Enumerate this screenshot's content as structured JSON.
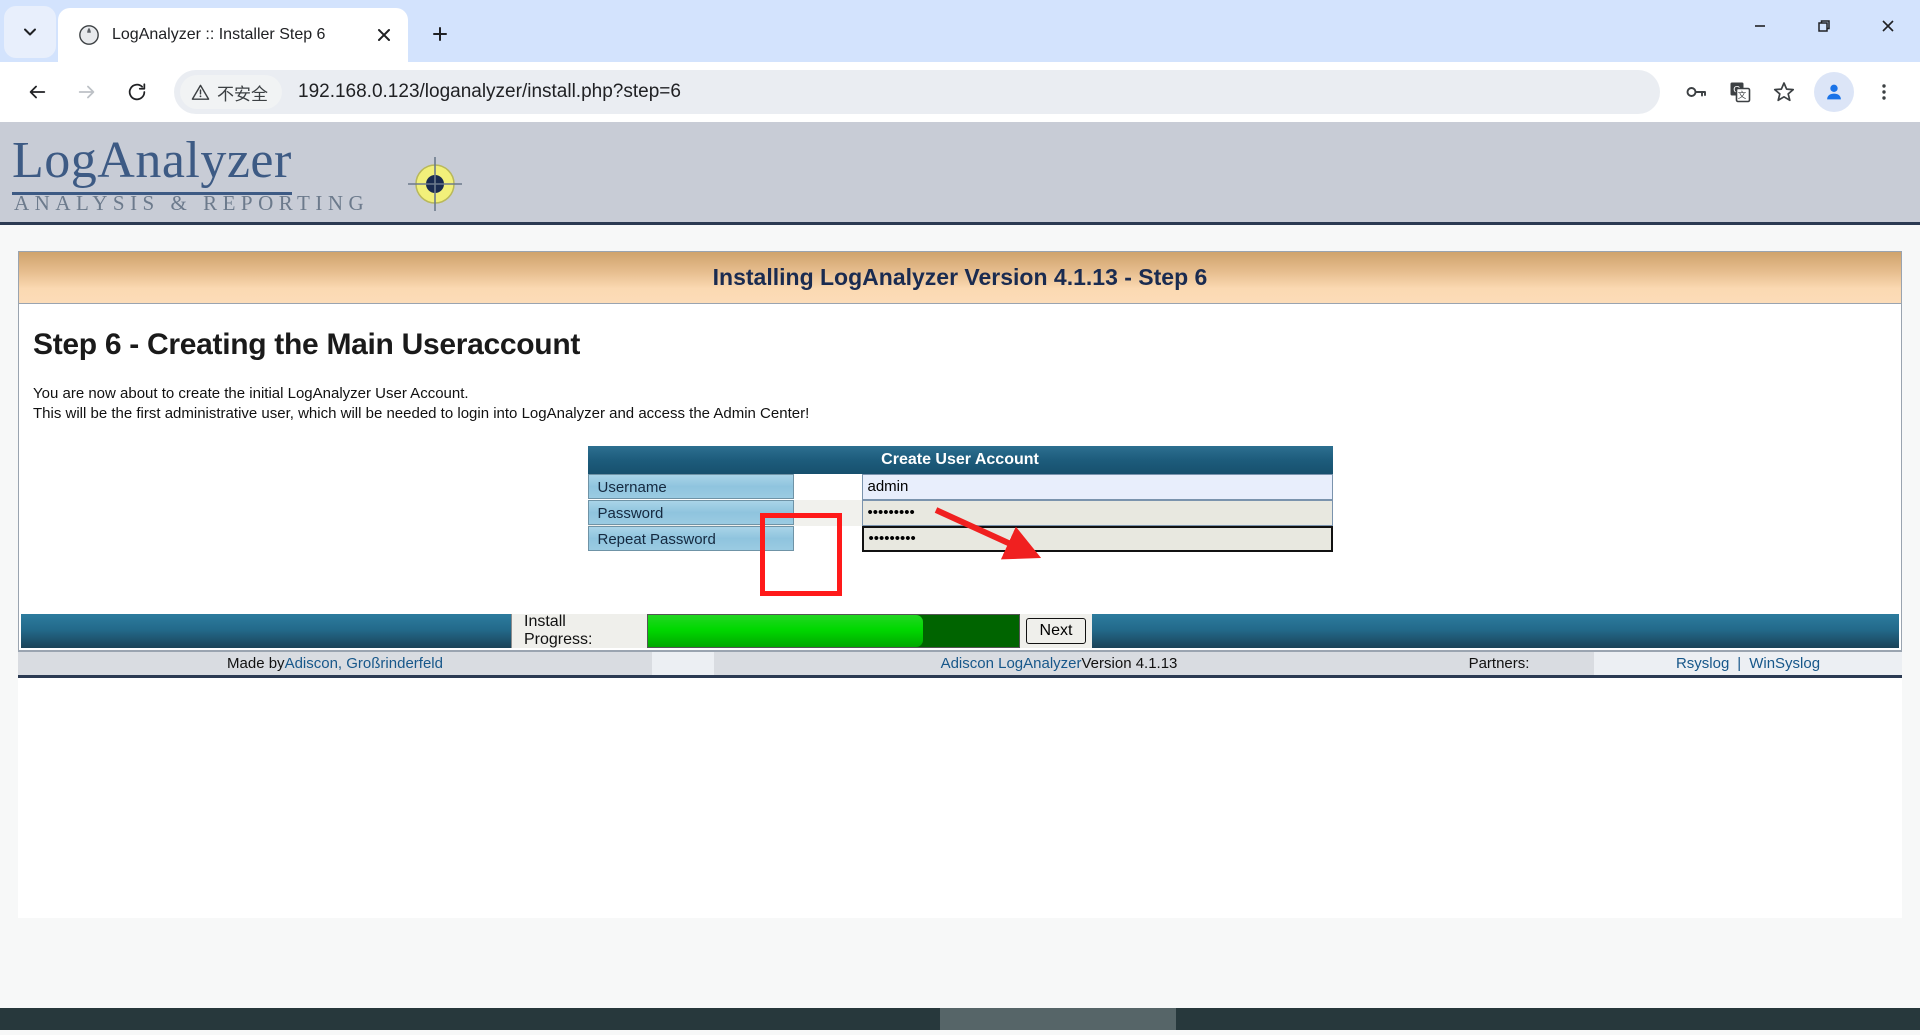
{
  "browser": {
    "tab": {
      "title": "LogAnalyzer :: Installer Step 6",
      "favicon_name": "globe-icon",
      "close_label": "✕"
    },
    "tab_search_icon": "chevron-down-icon",
    "new_tab_label": "+",
    "window_controls": {
      "minimize": "—",
      "restore": "❐",
      "close": "✕"
    },
    "nav": {
      "back": "←",
      "forward": "→",
      "reload": "↻"
    },
    "omnibox": {
      "security_label": "不安全",
      "security_icon": "warning-triangle-icon",
      "url": "192.168.0.123/loganalyzer/install.php?step=6"
    },
    "toolbar_icons": [
      "password-key-icon",
      "google-translate-icon",
      "bookmark-star-icon",
      "profile-avatar-icon",
      "three-dot-menu-icon"
    ]
  },
  "site": {
    "logo": {
      "main": "LogAnalyzer",
      "sub": "ANALYSIS & REPORTING",
      "target_icon": "crosshair-target-icon"
    },
    "banner": "Installing LogAnalyzer Version 4.1.13 - Step 6",
    "step_title": "Step 6 - Creating the Main Useraccount",
    "description_line1": "You are now about to create the initial LogAnalyzer User Account.",
    "description_line2": "This will be the first administrative user, which will be needed to login into LogAnalyzer and access the Admin Center!",
    "form": {
      "header": "Create User Account",
      "rows": [
        {
          "label": "Username",
          "value": "admin",
          "type": "text"
        },
        {
          "label": "Password",
          "value": "•••••••••",
          "type": "password"
        },
        {
          "label": "Repeat Password",
          "value": "•••••••••",
          "type": "password"
        }
      ]
    },
    "progress": {
      "label": "Install Progress:",
      "percent": 74
    },
    "next_button": "Next",
    "footer": {
      "made_by_prefix": "Made by ",
      "made_by_link": "Adiscon, Großrinderfeld",
      "product_link": "Adiscon LogAnalyzer",
      "product_version": " Version 4.1.13",
      "partners_label": "Partners:",
      "partner_1": "Rsyslog",
      "partner_sep": "|",
      "partner_2": "WinSyslog"
    }
  },
  "annotations": {
    "highlight_name": "red-rectangle-highlight",
    "arrow_name": "red-arrow-pointer",
    "color": "#ff1a1a"
  }
}
